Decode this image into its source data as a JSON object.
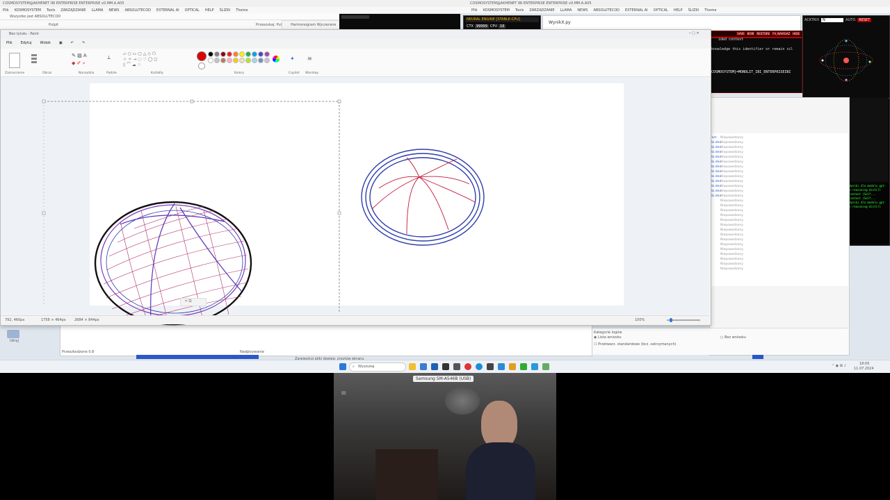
{
  "topbar": {
    "left_title": "COSMOSYSTEM@AKHENET IBI ENTERPRISE ENTERPRISE v0.MM.A.A05",
    "left_menu": [
      "Plik",
      "KOSMOSYSTEM",
      "Tools",
      "ZARZĄDZANIE",
      "LLAMA",
      "NEWS",
      "ABSOLUTECOD",
      "EXTERNAL AI",
      "OPTICAL",
      "HELP",
      "ŚLIZKI",
      "Theme"
    ],
    "right_title": "COSMOSYSTEM@AKHENET IBI ENTERPRISE ENTERPRISE v0.MM.A.A05",
    "right_menu": [
      "Plik",
      "KOSMOSYSTEM",
      "Tools",
      "ZARZĄDZANIE",
      "LLAMA",
      "NEWS",
      "ABSOLUTECOD",
      "EXTERNAL AI",
      "OPTICAL",
      "HELP",
      "ŚLIZKI",
      "Theme"
    ],
    "secondary_title": "Wszystko jest ABSOLUTECOD",
    "browser_tab": "Pulpit",
    "search_label": "Przeszukaj: Pulpit",
    "explorer_label": "Harmonogram Wyczerane"
  },
  "neural": {
    "title": "NEURAL ENGINE [STABLE-CPU]",
    "ctx_label": "CTX",
    "ctx_value": "99999",
    "cpu_label": "CPU",
    "cpu_value": "16"
  },
  "editor": {
    "file_tab": "WynikX.py"
  },
  "terminal": {
    "buttons": [
      "SAVE",
      "BOW",
      "RESTORE",
      "FV_NAVIGAZ",
      "HIDE"
    ],
    "line1": "ided context",
    "line2": "knowledge this identifier or remain sil",
    "line3": "COSMOSYSTEM}=MONOLIT_IBI_ENTERPRISEIBI"
  },
  "ai_panel": {
    "title": "ACKTRIX",
    "field_value": "N",
    "auto_label": "AUTO",
    "reset_label": "RESET",
    "log_lines": [
      "Wyniki dla modelu gpt-",
      "o-reasoning-distill",
      "context (Self...",
      "context (Self...",
      "Wyniki dla modelu gpt-",
      "o-reasoning-distill"
    ]
  },
  "paint": {
    "window_title": "Bez tytułu - Paint",
    "menu": [
      "Plik",
      "Edytuj",
      "Widok"
    ],
    "groups": [
      "Zaznaczenie",
      "Obraz",
      "Narzędzia",
      "Pędzle",
      "Kształty",
      "Kolory",
      "Copilot",
      "Warstwy"
    ],
    "status_cursor": "792, 460px",
    "status_selection": "1758 × 464px",
    "status_size": "2684 × 844px",
    "zoom": "100%",
    "colors": {
      "accent": "#e00000",
      "palette": [
        "#000000",
        "#7f7f7f",
        "#880015",
        "#ed1c24",
        "#ff7f27",
        "#fff200",
        "#22b14c",
        "#00a2e8",
        "#3f48cc",
        "#a349a4",
        "#ffffff",
        "#c3c3c3",
        "#b97a57",
        "#ffaec9",
        "#ffc90e",
        "#efe4b0",
        "#b5e61d",
        "#99d9ea",
        "#7092be",
        "#c8bfe7"
      ]
    }
  },
  "list_panel": {
    "items": [
      {
        "tag": "fam",
        "text": "Niepowodzony"
      },
      {
        "tag": "ibi.dev",
        "text": "Niepowodzony"
      },
      {
        "tag": "ibi.dev",
        "text": "Niepowodzony"
      },
      {
        "tag": "ibi.dev",
        "text": "Niepowodzony"
      },
      {
        "tag": "ibi.dev",
        "text": "Niepowodzony"
      },
      {
        "tag": "ibi.dev",
        "text": "Niepowodzony"
      },
      {
        "tag": "ibi.dev",
        "text": "Niepowodzony"
      },
      {
        "tag": "ibi.dev",
        "text": "Niepowodzony"
      },
      {
        "tag": "ibi.dev",
        "text": "Niepowodzony"
      },
      {
        "tag": "ibi.dev",
        "text": "Niepowodzony"
      },
      {
        "tag": "ibi.dev",
        "text": "Niepowodzony"
      },
      {
        "tag": "ibi.dev",
        "text": "Niepowodzony"
      },
      {
        "tag": "ibi.dev",
        "text": "Niepowodzony"
      },
      {
        "tag": "",
        "text": "Niepowodzony"
      },
      {
        "tag": "",
        "text": "Niepowodzony"
      },
      {
        "tag": "",
        "text": "Niepowodzony"
      },
      {
        "tag": "",
        "text": "Niepowodzony"
      },
      {
        "tag": "",
        "text": "Niepowodzony"
      },
      {
        "tag": "",
        "text": "Niepowodzony"
      },
      {
        "tag": "",
        "text": "Niepowodzony"
      },
      {
        "tag": "",
        "text": "Niepowodzony"
      },
      {
        "tag": "",
        "text": "Niepowodzony"
      },
      {
        "tag": "",
        "text": "Niepowodzony"
      },
      {
        "tag": "",
        "text": "Niepowodzony"
      },
      {
        "tag": "",
        "text": "Niepowodzony"
      },
      {
        "tag": "",
        "text": "Niepowodzony"
      },
      {
        "tag": "",
        "text": "Niepowodzony"
      },
      {
        "tag": "",
        "text": "Niepowodzony"
      }
    ],
    "options_title": "Kategorie logów",
    "option1": "Lista wniosku",
    "option2": "Przetwarz. standardowe (bcz. zatrzymanych)",
    "option3": "Bez wniosku"
  },
  "background_windows": {
    "status_left": "Przeszkodzone 0.8",
    "status_mid": "Nadpisywanie",
    "status_bottom": "Ukryj",
    "bottom_line": "Zarejestruj pliki dostęp: zrzutów ekranu"
  },
  "taskbar": {
    "search_placeholder": "Wyszukaj",
    "time": "18:05",
    "date": "11.07.2024",
    "icons": [
      "windows-start-icon",
      "folder-icon",
      "store-icon",
      "mail-icon",
      "terminal-icon",
      "chrome-icon",
      "edge-icon",
      "settings-icon",
      "photos-icon",
      "python-icon",
      "code-icon",
      "explorer-icon"
    ]
  },
  "webcam": {
    "device_label": "Samsung SM-A546B (USB)"
  }
}
